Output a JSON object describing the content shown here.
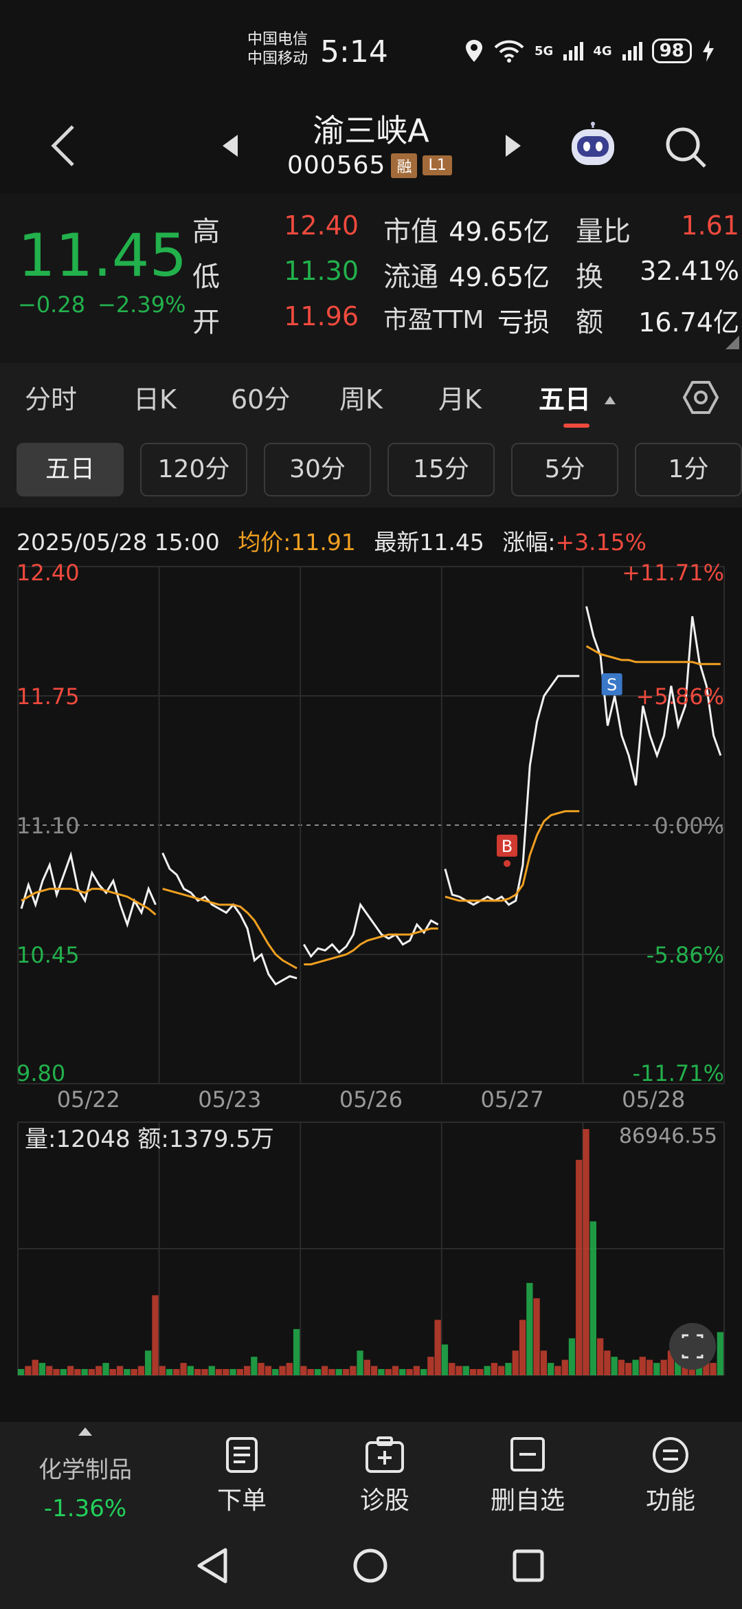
{
  "status": {
    "carrier1": "中国电信",
    "carrier2": "中国移动",
    "time": "5:14",
    "signal1": "5G",
    "signal2": "4G",
    "battery": "98"
  },
  "header": {
    "title": "渝三峡A",
    "code": "000565",
    "badge_rong": "融",
    "badge_l1": "L1"
  },
  "quote": {
    "price": "11.45",
    "change": "−0.28",
    "change_pct": "−2.39%",
    "high_label": "高",
    "high": "12.40",
    "low_label": "低",
    "low": "11.30",
    "open_label": "开",
    "open": "11.96",
    "mcap_label": "市值",
    "mcap": "49.65亿",
    "float_label": "流通",
    "float": "49.65亿",
    "pe_label": "市盈TTM",
    "pe": "亏损",
    "vr_label": "量比",
    "vr": "1.61",
    "turn_label": "换",
    "turn": "32.41%",
    "amt_label": "额",
    "amt": "16.74亿"
  },
  "tabs": [
    "分时",
    "日K",
    "60分",
    "周K",
    "月K",
    "五日"
  ],
  "subtabs": [
    "五日",
    "120分",
    "30分",
    "15分",
    "5分",
    "1分"
  ],
  "chart_info": {
    "datetime": "2025/05/28 15:00",
    "avg": "均价:11.91",
    "latest": "最新11.45",
    "chg_label": "涨幅:",
    "chg": "+3.15%"
  },
  "chart_data": {
    "type": "line",
    "x": [
      "05/22",
      "05/23",
      "05/26",
      "05/27",
      "05/28"
    ],
    "price_axis": [
      "12.40",
      "11.75",
      "11.10",
      "10.45",
      "9.80"
    ],
    "pct_axis": [
      "+11.71%",
      "+5.86%",
      "0.00%",
      "-5.86%",
      "-11.71%"
    ],
    "ylim": [
      9.8,
      12.4
    ],
    "prev_close": 11.1,
    "series": [
      {
        "name": "price",
        "color": "#f2f2f2",
        "values": [
          10.68,
          10.8,
          10.7,
          10.82,
          10.9,
          10.75,
          10.85,
          10.95,
          10.78,
          10.72,
          10.86,
          10.8,
          10.76,
          10.82,
          10.7,
          10.6,
          10.72,
          10.66,
          10.78,
          10.7,
          10.96,
          10.88,
          10.85,
          10.78,
          10.76,
          10.72,
          10.74,
          10.7,
          10.68,
          10.66,
          10.7,
          10.65,
          10.58,
          10.42,
          10.45,
          10.35,
          10.3,
          10.32,
          10.34,
          10.33,
          10.5,
          10.44,
          10.48,
          10.47,
          10.5,
          10.46,
          10.49,
          10.55,
          10.7,
          10.65,
          10.6,
          10.55,
          10.53,
          10.55,
          10.5,
          10.52,
          10.6,
          10.56,
          10.62,
          10.6,
          10.88,
          10.75,
          10.74,
          10.72,
          10.7,
          10.72,
          10.74,
          10.72,
          10.74,
          10.7,
          10.72,
          10.9,
          11.4,
          11.62,
          11.75,
          11.8,
          11.85,
          11.85,
          11.85,
          11.85,
          12.2,
          12.05,
          11.95,
          11.6,
          11.75,
          11.55,
          11.45,
          11.3,
          11.7,
          11.55,
          11.45,
          11.55,
          11.8,
          11.6,
          11.7,
          12.15,
          11.92,
          11.8,
          11.55,
          11.45
        ]
      },
      {
        "name": "avg",
        "color": "#f0a020",
        "values": [
          10.72,
          10.74,
          10.76,
          10.77,
          10.78,
          10.78,
          10.78,
          10.78,
          10.77,
          10.76,
          10.78,
          10.78,
          10.77,
          10.76,
          10.75,
          10.74,
          10.72,
          10.7,
          10.68,
          10.65,
          10.78,
          10.77,
          10.76,
          10.75,
          10.74,
          10.73,
          10.72,
          10.71,
          10.7,
          10.7,
          10.7,
          10.69,
          10.66,
          10.62,
          10.56,
          10.5,
          10.45,
          10.42,
          10.4,
          10.38,
          10.4,
          10.4,
          10.41,
          10.42,
          10.43,
          10.44,
          10.45,
          10.47,
          10.5,
          10.52,
          10.53,
          10.54,
          10.55,
          10.55,
          10.55,
          10.55,
          10.56,
          10.57,
          10.58,
          10.58,
          10.74,
          10.73,
          10.72,
          10.72,
          10.72,
          10.72,
          10.72,
          10.72,
          10.72,
          10.73,
          10.75,
          10.8,
          10.95,
          11.05,
          11.12,
          11.15,
          11.16,
          11.17,
          11.17,
          11.17,
          12.0,
          11.98,
          11.96,
          11.95,
          11.94,
          11.93,
          11.93,
          11.92,
          11.92,
          11.92,
          11.92,
          11.92,
          11.92,
          11.92,
          11.92,
          11.92,
          11.91,
          11.91,
          11.91,
          11.91
        ]
      }
    ],
    "volume": {
      "label": "量:12048",
      "amount": "额:1379.5万",
      "max": "86946.55",
      "values": [
        2,
        3,
        5,
        4,
        3,
        2,
        2,
        3,
        2,
        2,
        2,
        3,
        4,
        2,
        3,
        2,
        2,
        3,
        8,
        26,
        3,
        2,
        2,
        4,
        3,
        2,
        2,
        3,
        2,
        2,
        2,
        2,
        3,
        6,
        4,
        3,
        2,
        3,
        4,
        15,
        3,
        2,
        2,
        3,
        2,
        2,
        2,
        3,
        8,
        5,
        3,
        2,
        2,
        3,
        2,
        2,
        3,
        2,
        6,
        18,
        10,
        4,
        3,
        3,
        2,
        2,
        3,
        4,
        3,
        4,
        8,
        18,
        30,
        25,
        8,
        4,
        3,
        5,
        12,
        70,
        80,
        50,
        12,
        8,
        6,
        5,
        4,
        5,
        6,
        5,
        4,
        5,
        8,
        6,
        5,
        8,
        6,
        5,
        4,
        14
      ]
    }
  },
  "bottom": {
    "sector": "化学制品",
    "sector_chg": "-1.36%",
    "order": "下单",
    "diagnose": "诊股",
    "remove_watch": "删自选",
    "functions": "功能"
  }
}
